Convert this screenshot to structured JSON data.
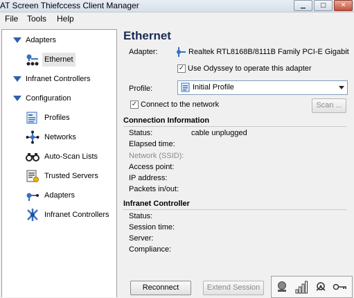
{
  "window": {
    "title": "AT Screen Thiefccess Client Manager",
    "buttons": {
      "minimize": "▁",
      "maximize": "□",
      "close": "✕"
    }
  },
  "menu": {
    "items": [
      "File",
      "Tools",
      "Help"
    ]
  },
  "sidebar": {
    "adapters_header": "Adapters",
    "ethernet": "Ethernet",
    "infranet_header": "Infranet Controllers",
    "configuration_header": "Configuration",
    "config_items": [
      "Profiles",
      "Networks",
      "Auto-Scan Lists",
      "Trusted Servers",
      "Adapters",
      "Infranet Controllers"
    ]
  },
  "main": {
    "title": "Ethernet",
    "adapter_label": "Adapter:",
    "adapter_value": "Realtek RTL8168B/8111B Family PCI-E Gigabit",
    "use_odyssey_label": "Use Odyssey to operate this adapter",
    "use_odyssey_checked": true,
    "profile_label": "Profile:",
    "profile_value": "Initial Profile",
    "connect_label": "Connect to the network",
    "connect_checked": true,
    "scan_button": "Scan ...",
    "connection_info": {
      "title": "Connection Information",
      "status_label": "Status:",
      "status_value": "cable unplugged",
      "elapsed_label": "Elapsed time:",
      "ssid_label": "Network (SSID):",
      "access_point_label": "Access point:",
      "ip_label": "IP address:",
      "packets_label": "Packets in/out:"
    },
    "infranet_controller": {
      "title": "Infranet Controller",
      "status_label": "Status:",
      "session_label": "Session time:",
      "server_label": "Server:",
      "compliance_label": "Compliance:"
    },
    "reconnect_button": "Reconnect",
    "extend_session_button": "Extend Session"
  },
  "tray_icons": [
    "connection-status-icon",
    "signal-strength-icon",
    "security-icon",
    "key-icon"
  ]
}
